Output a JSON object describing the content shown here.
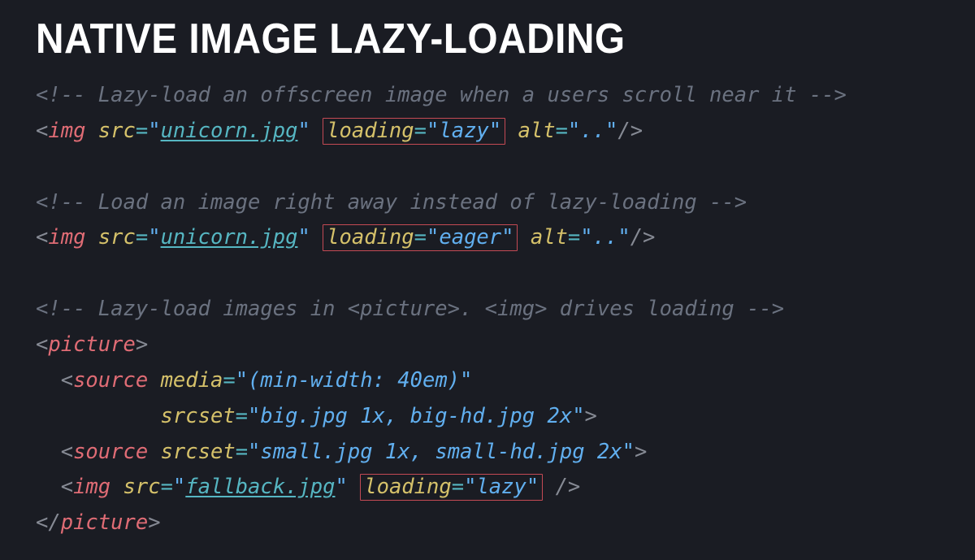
{
  "title": "NATIVE IMAGE LAZY-LOADING",
  "code": {
    "c1": "<!-- Lazy-load an offscreen image when a users scroll near it -->",
    "l1": {
      "tag": "img",
      "src_attr": "src",
      "src_val": "unicorn.jpg",
      "load_attr": "loading",
      "load_val": "lazy",
      "alt_attr": "alt",
      "alt_val": ".."
    },
    "c2": "<!-- Load an image right away instead of lazy-loading -->",
    "l2": {
      "tag": "img",
      "src_attr": "src",
      "src_val": "unicorn.jpg",
      "load_attr": "loading",
      "load_val": "eager",
      "alt_attr": "alt",
      "alt_val": ".."
    },
    "c3": "<!-- Lazy-load images in <picture>. <img> drives loading -->",
    "picture_open": "picture",
    "s1": {
      "tag": "source",
      "media_attr": "media",
      "media_val": "(min-width: 40em)",
      "srcset_attr": "srcset",
      "srcset_val": "big.jpg 1x, big-hd.jpg 2x"
    },
    "s2": {
      "tag": "source",
      "srcset_attr": "srcset",
      "srcset_val": "small.jpg 1x, small-hd.jpg 2x"
    },
    "l3": {
      "tag": "img",
      "src_attr": "src",
      "src_val": "fallback.jpg",
      "load_attr": "loading",
      "load_val": "lazy"
    },
    "picture_close": "picture"
  },
  "q": "\"",
  "eq": "=",
  "lt": "<",
  "gt": ">",
  "slashgt": "/>",
  "ltslash": "</"
}
